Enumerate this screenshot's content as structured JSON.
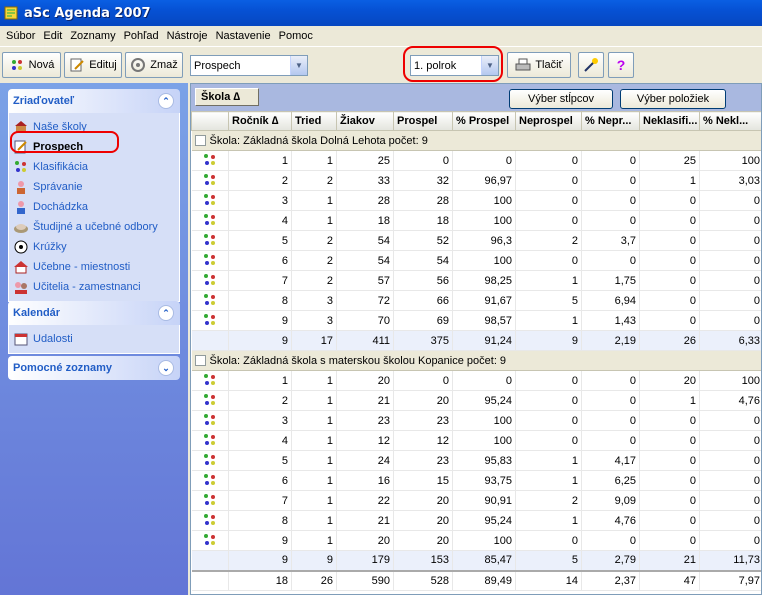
{
  "window": {
    "title": "aSc Agenda 2007"
  },
  "menu": [
    "Súbor",
    "Edit",
    "Zoznamy",
    "Pohľad",
    "Nástroje",
    "Nastavenie",
    "Pomoc"
  ],
  "toolbar": {
    "new_label": "Nová",
    "edit_label": "Edituj",
    "delete_label": "Zmaž",
    "view_select": "Prospech",
    "period_select": "1. polrok",
    "print_label": "Tlačiť"
  },
  "sidebar": {
    "panel1": {
      "title": "Zriaďovateľ",
      "items": [
        {
          "label": "Naše školy",
          "icon": "school-icon"
        },
        {
          "label": "Prospech",
          "icon": "grades-icon",
          "selected": true
        },
        {
          "label": "Klasifikácia",
          "icon": "classification-icon"
        },
        {
          "label": "Správanie",
          "icon": "behavior-icon"
        },
        {
          "label": "Dochádzka",
          "icon": "attendance-icon"
        },
        {
          "label": "Študijné a učebné odbory",
          "icon": "book-icon"
        },
        {
          "label": "Krúžky",
          "icon": "ball-icon"
        },
        {
          "label": "Učebne - miestnosti",
          "icon": "room-icon"
        },
        {
          "label": "Učitelia - zamestnanci",
          "icon": "teachers-icon"
        }
      ]
    },
    "panel2": {
      "title": "Kalendár",
      "items": [
        {
          "label": "Udalosti",
          "icon": "calendar-icon"
        }
      ]
    },
    "panel3": {
      "title": "Pomocné zoznamy"
    }
  },
  "grid": {
    "group_chip": "Škola",
    "btn_columns": "Výber stĺpcov",
    "btn_items": "Výber položiek",
    "headers": [
      "Ročník",
      "Tried",
      "Žiakov",
      "Prospel",
      "% Prospel",
      "Neprospel",
      "% Nepr...",
      "Neklasifi...",
      "% Nekl..."
    ],
    "groups": [
      {
        "title": "Škola:  Základná škola Dolná Lehota  počet: 9",
        "rows": [
          [
            "1",
            "1",
            "25",
            "0",
            "0",
            "0",
            "0",
            "25",
            "100"
          ],
          [
            "2",
            "2",
            "33",
            "32",
            "96,97",
            "0",
            "0",
            "1",
            "3,03"
          ],
          [
            "3",
            "1",
            "28",
            "28",
            "100",
            "0",
            "0",
            "0",
            "0"
          ],
          [
            "4",
            "1",
            "18",
            "18",
            "100",
            "0",
            "0",
            "0",
            "0"
          ],
          [
            "5",
            "2",
            "54",
            "52",
            "96,3",
            "2",
            "3,7",
            "0",
            "0"
          ],
          [
            "6",
            "2",
            "54",
            "54",
            "100",
            "0",
            "0",
            "0",
            "0"
          ],
          [
            "7",
            "2",
            "57",
            "56",
            "98,25",
            "1",
            "1,75",
            "0",
            "0"
          ],
          [
            "8",
            "3",
            "72",
            "66",
            "91,67",
            "5",
            "6,94",
            "0",
            "0"
          ],
          [
            "9",
            "3",
            "70",
            "69",
            "98,57",
            "1",
            "1,43",
            "0",
            "0"
          ]
        ],
        "sum": [
          "9",
          "17",
          "411",
          "375",
          "91,24",
          "9",
          "2,19",
          "26",
          "6,33"
        ]
      },
      {
        "title": "Škola:  Základná škola s materskou školou Kopanice  počet: 9",
        "rows": [
          [
            "1",
            "1",
            "20",
            "0",
            "0",
            "0",
            "0",
            "20",
            "100"
          ],
          [
            "2",
            "1",
            "21",
            "20",
            "95,24",
            "0",
            "0",
            "1",
            "4,76"
          ],
          [
            "3",
            "1",
            "23",
            "23",
            "100",
            "0",
            "0",
            "0",
            "0"
          ],
          [
            "4",
            "1",
            "12",
            "12",
            "100",
            "0",
            "0",
            "0",
            "0"
          ],
          [
            "5",
            "1",
            "24",
            "23",
            "95,83",
            "1",
            "4,17",
            "0",
            "0"
          ],
          [
            "6",
            "1",
            "16",
            "15",
            "93,75",
            "1",
            "6,25",
            "0",
            "0"
          ],
          [
            "7",
            "1",
            "22",
            "20",
            "90,91",
            "2",
            "9,09",
            "0",
            "0"
          ],
          [
            "8",
            "1",
            "21",
            "20",
            "95,24",
            "1",
            "4,76",
            "0",
            "0"
          ],
          [
            "9",
            "1",
            "20",
            "20",
            "100",
            "0",
            "0",
            "0",
            "0"
          ]
        ],
        "sum": [
          "9",
          "9",
          "179",
          "153",
          "85,47",
          "5",
          "2,79",
          "21",
          "11,73"
        ]
      }
    ],
    "grand": [
      "18",
      "26",
      "590",
      "528",
      "89,49",
      "14",
      "2,37",
      "47",
      "7,97"
    ]
  }
}
